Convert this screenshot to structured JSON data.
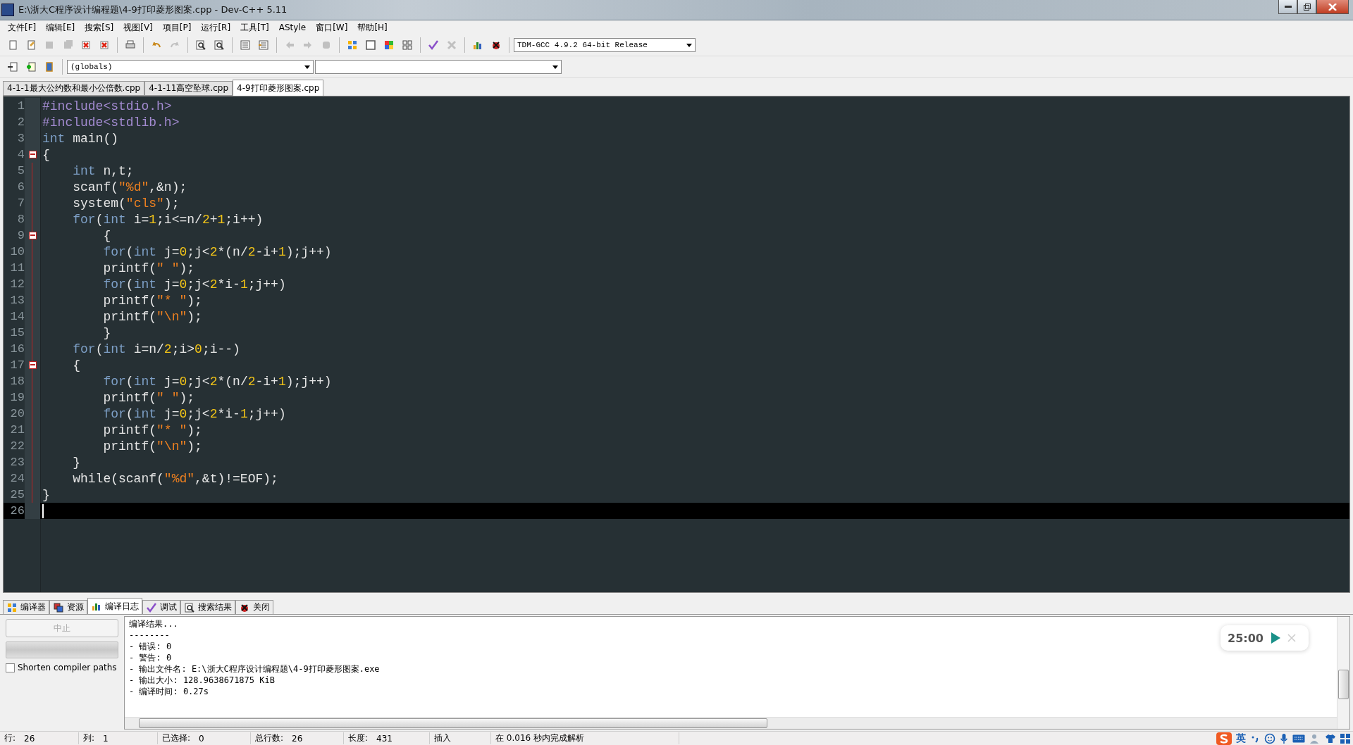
{
  "window": {
    "title": "E:\\浙大C程序设计编程题\\4-9打印菱形图案.cpp - Dev-C++ 5.11"
  },
  "menu": [
    "文件[F]",
    "编辑[E]",
    "搜索[S]",
    "视图[V]",
    "项目[P]",
    "运行[R]",
    "工具[T]",
    "AStyle",
    "窗口[W]",
    "帮助[H]"
  ],
  "toolbar": [
    {
      "kind": "new",
      "disabled": false
    },
    {
      "kind": "open",
      "disabled": false
    },
    {
      "kind": "save",
      "disabled": true
    },
    {
      "kind": "saveall",
      "disabled": true
    },
    {
      "kind": "close",
      "disabled": false
    },
    {
      "kind": "closeall",
      "disabled": false
    },
    {
      "kind": "sep"
    },
    {
      "kind": "print",
      "disabled": false
    },
    {
      "kind": "sep"
    },
    {
      "kind": "undo",
      "disabled": false
    },
    {
      "kind": "redo",
      "disabled": true
    },
    {
      "kind": "sep"
    },
    {
      "kind": "find",
      "disabled": false
    },
    {
      "kind": "replace",
      "disabled": false
    },
    {
      "kind": "sep"
    },
    {
      "kind": "indent",
      "disabled": false
    },
    {
      "kind": "unindent",
      "disabled": false
    },
    {
      "kind": "sep"
    },
    {
      "kind": "back",
      "disabled": true
    },
    {
      "kind": "forward",
      "disabled": true
    },
    {
      "kind": "bookmark",
      "disabled": true
    },
    {
      "kind": "sep"
    },
    {
      "kind": "tiles",
      "disabled": false
    },
    {
      "kind": "window",
      "disabled": false
    },
    {
      "kind": "colorgrid",
      "disabled": false
    },
    {
      "kind": "grid",
      "disabled": false
    },
    {
      "kind": "sep"
    },
    {
      "kind": "check",
      "disabled": false
    },
    {
      "kind": "stop",
      "disabled": true
    },
    {
      "kind": "sep"
    },
    {
      "kind": "chart",
      "disabled": false
    },
    {
      "kind": "debug",
      "disabled": false
    }
  ],
  "compiler_select": {
    "value": "TDM-GCC 4.9.2 64-bit Release"
  },
  "toolbar2": [
    {
      "kind": "insert",
      "disabled": false
    },
    {
      "kind": "add",
      "disabled": false
    },
    {
      "kind": "class",
      "disabled": false
    }
  ],
  "scope_select": {
    "value": "(globals)"
  },
  "file_tabs": [
    {
      "label": "4-1-1最大公约数和最小公倍数.cpp",
      "selected": false
    },
    {
      "label": "4-1-11高空坠球.cpp",
      "selected": false
    },
    {
      "label": "4-9打印菱形图案.cpp",
      "selected": true
    }
  ],
  "editor": {
    "lines": [
      {
        "num": "1",
        "fold": false,
        "current": false,
        "tokens": [
          {
            "kind": "pre",
            "text": "#include<stdio.h>"
          }
        ]
      },
      {
        "num": "2",
        "fold": false,
        "current": false,
        "tokens": [
          {
            "kind": "pre",
            "text": "#include<stdlib.h>"
          }
        ]
      },
      {
        "num": "3",
        "fold": false,
        "current": false,
        "tokens": [
          {
            "kind": "kw",
            "text": "int"
          },
          {
            "kind": "plain",
            "text": " main()"
          }
        ]
      },
      {
        "num": "4",
        "fold": true,
        "current": false,
        "tokens": [
          {
            "kind": "plain",
            "text": "{"
          }
        ]
      },
      {
        "num": "5",
        "fold": false,
        "current": false,
        "tokens": [
          {
            "kind": "kw",
            "text": "    int"
          },
          {
            "kind": "plain",
            "text": " n,t;"
          }
        ]
      },
      {
        "num": "6",
        "fold": false,
        "current": false,
        "tokens": [
          {
            "kind": "plain",
            "text": "    scanf("
          },
          {
            "kind": "str",
            "text": "\"%d\""
          },
          {
            "kind": "plain",
            "text": ",&n);"
          }
        ]
      },
      {
        "num": "7",
        "fold": false,
        "current": false,
        "tokens": [
          {
            "kind": "plain",
            "text": "    system("
          },
          {
            "kind": "str",
            "text": "\"cls\""
          },
          {
            "kind": "plain",
            "text": ");"
          }
        ]
      },
      {
        "num": "8",
        "fold": false,
        "current": false,
        "tokens": [
          {
            "kind": "kw",
            "text": "    for"
          },
          {
            "kind": "plain",
            "text": "("
          },
          {
            "kind": "kw",
            "text": "int"
          },
          {
            "kind": "plain",
            "text": " i="
          },
          {
            "kind": "num",
            "text": "1"
          },
          {
            "kind": "plain",
            "text": ";i<=n/"
          },
          {
            "kind": "num",
            "text": "2"
          },
          {
            "kind": "plain",
            "text": "+"
          },
          {
            "kind": "num",
            "text": "1"
          },
          {
            "kind": "plain",
            "text": ";i++)"
          }
        ]
      },
      {
        "num": "9",
        "fold": true,
        "current": false,
        "tokens": [
          {
            "kind": "plain",
            "text": "        {"
          }
        ]
      },
      {
        "num": "10",
        "fold": false,
        "current": false,
        "tokens": [
          {
            "kind": "kw",
            "text": "        for"
          },
          {
            "kind": "plain",
            "text": "("
          },
          {
            "kind": "kw",
            "text": "int"
          },
          {
            "kind": "plain",
            "text": " j="
          },
          {
            "kind": "num",
            "text": "0"
          },
          {
            "kind": "plain",
            "text": ";j<"
          },
          {
            "kind": "num",
            "text": "2"
          },
          {
            "kind": "plain",
            "text": "*(n/"
          },
          {
            "kind": "num",
            "text": "2"
          },
          {
            "kind": "plain",
            "text": "-i+"
          },
          {
            "kind": "num",
            "text": "1"
          },
          {
            "kind": "plain",
            "text": ");j++)"
          }
        ]
      },
      {
        "num": "11",
        "fold": false,
        "current": false,
        "tokens": [
          {
            "kind": "plain",
            "text": "        printf("
          },
          {
            "kind": "str",
            "text": "\" \""
          },
          {
            "kind": "plain",
            "text": ");"
          }
        ]
      },
      {
        "num": "12",
        "fold": false,
        "current": false,
        "tokens": [
          {
            "kind": "kw",
            "text": "        for"
          },
          {
            "kind": "plain",
            "text": "("
          },
          {
            "kind": "kw",
            "text": "int"
          },
          {
            "kind": "plain",
            "text": " j="
          },
          {
            "kind": "num",
            "text": "0"
          },
          {
            "kind": "plain",
            "text": ";j<"
          },
          {
            "kind": "num",
            "text": "2"
          },
          {
            "kind": "plain",
            "text": "*i-"
          },
          {
            "kind": "num",
            "text": "1"
          },
          {
            "kind": "plain",
            "text": ";j++)"
          }
        ]
      },
      {
        "num": "13",
        "fold": false,
        "current": false,
        "tokens": [
          {
            "kind": "plain",
            "text": "        printf("
          },
          {
            "kind": "str",
            "text": "\"* \""
          },
          {
            "kind": "plain",
            "text": ");"
          }
        ]
      },
      {
        "num": "14",
        "fold": false,
        "current": false,
        "tokens": [
          {
            "kind": "plain",
            "text": "        printf("
          },
          {
            "kind": "str",
            "text": "\"\\n\""
          },
          {
            "kind": "plain",
            "text": ");"
          }
        ]
      },
      {
        "num": "15",
        "fold": false,
        "current": false,
        "tokens": [
          {
            "kind": "plain",
            "text": "        }"
          }
        ]
      },
      {
        "num": "16",
        "fold": false,
        "current": false,
        "tokens": [
          {
            "kind": "kw",
            "text": "    for"
          },
          {
            "kind": "plain",
            "text": "("
          },
          {
            "kind": "kw",
            "text": "int"
          },
          {
            "kind": "plain",
            "text": " i=n/"
          },
          {
            "kind": "num",
            "text": "2"
          },
          {
            "kind": "plain",
            "text": ";i>"
          },
          {
            "kind": "num",
            "text": "0"
          },
          {
            "kind": "plain",
            "text": ";i--)"
          }
        ]
      },
      {
        "num": "17",
        "fold": true,
        "current": false,
        "tokens": [
          {
            "kind": "plain",
            "text": "    {"
          }
        ]
      },
      {
        "num": "18",
        "fold": false,
        "current": false,
        "tokens": [
          {
            "kind": "kw",
            "text": "        for"
          },
          {
            "kind": "plain",
            "text": "("
          },
          {
            "kind": "kw",
            "text": "int"
          },
          {
            "kind": "plain",
            "text": " j="
          },
          {
            "kind": "num",
            "text": "0"
          },
          {
            "kind": "plain",
            "text": ";j<"
          },
          {
            "kind": "num",
            "text": "2"
          },
          {
            "kind": "plain",
            "text": "*(n/"
          },
          {
            "kind": "num",
            "text": "2"
          },
          {
            "kind": "plain",
            "text": "-i+"
          },
          {
            "kind": "num",
            "text": "1"
          },
          {
            "kind": "plain",
            "text": ");j++)"
          }
        ]
      },
      {
        "num": "19",
        "fold": false,
        "current": false,
        "tokens": [
          {
            "kind": "plain",
            "text": "        printf("
          },
          {
            "kind": "str",
            "text": "\" \""
          },
          {
            "kind": "plain",
            "text": ");"
          }
        ]
      },
      {
        "num": "20",
        "fold": false,
        "current": false,
        "tokens": [
          {
            "kind": "kw",
            "text": "        for"
          },
          {
            "kind": "plain",
            "text": "("
          },
          {
            "kind": "kw",
            "text": "int"
          },
          {
            "kind": "plain",
            "text": " j="
          },
          {
            "kind": "num",
            "text": "0"
          },
          {
            "kind": "plain",
            "text": ";j<"
          },
          {
            "kind": "num",
            "text": "2"
          },
          {
            "kind": "plain",
            "text": "*i-"
          },
          {
            "kind": "num",
            "text": "1"
          },
          {
            "kind": "plain",
            "text": ";j++)"
          }
        ]
      },
      {
        "num": "21",
        "fold": false,
        "current": false,
        "tokens": [
          {
            "kind": "plain",
            "text": "        printf("
          },
          {
            "kind": "str",
            "text": "\"* \""
          },
          {
            "kind": "plain",
            "text": ");"
          }
        ]
      },
      {
        "num": "22",
        "fold": false,
        "current": false,
        "tokens": [
          {
            "kind": "plain",
            "text": "        printf("
          },
          {
            "kind": "str",
            "text": "\"\\n\""
          },
          {
            "kind": "plain",
            "text": ");"
          }
        ]
      },
      {
        "num": "23",
        "fold": false,
        "current": false,
        "tokens": [
          {
            "kind": "plain",
            "text": "    }"
          }
        ]
      },
      {
        "num": "24",
        "fold": false,
        "current": false,
        "tokens": [
          {
            "kind": "plain",
            "text": "    while(scanf("
          },
          {
            "kind": "str",
            "text": "\"%d\""
          },
          {
            "kind": "plain",
            "text": ",&t)!=EOF);"
          }
        ]
      },
      {
        "num": "25",
        "fold": false,
        "current": false,
        "tokens": [
          {
            "kind": "plain",
            "text": "}"
          }
        ]
      },
      {
        "num": "26",
        "fold": false,
        "current": true
      }
    ]
  },
  "bottom_tabs": [
    {
      "kind": "compiler",
      "label": "编译器",
      "selected": false
    },
    {
      "kind": "resources",
      "label": "资源",
      "selected": false
    },
    {
      "kind": "log",
      "label": "编译日志",
      "selected": true
    },
    {
      "kind": "debug",
      "label": "调试",
      "selected": false
    },
    {
      "kind": "search",
      "label": "搜索结果",
      "selected": false
    },
    {
      "kind": "close",
      "label": "关闭",
      "selected": false
    }
  ],
  "log_panel": {
    "abort_button": {
      "label": "中止",
      "disabled": true
    },
    "progress": {
      "level": 0
    },
    "shorten_paths": {
      "label": "Shorten compiler paths",
      "checked": false
    },
    "output": [
      "编译结果...",
      "--------",
      "- 错误: 0",
      "- 警告: 0",
      "- 输出文件名: E:\\浙大C程序设计编程题\\4-9打印菱形图案.exe",
      "- 输出大小: 128.9638671875 KiB",
      "- 编译时间: 0.27s"
    ]
  },
  "timer": {
    "time": "25:00"
  },
  "status_bar": [
    {
      "label": "行:",
      "value": "26"
    },
    {
      "label": "列:",
      "value": "1"
    },
    {
      "label": "已选择:",
      "value": "0"
    },
    {
      "label": "总行数:",
      "value": "26"
    },
    {
      "label": "长度:",
      "value": "431"
    },
    {
      "value": "插入"
    },
    {
      "value": "在 0.016 秒内完成解析"
    }
  ],
  "ime": {
    "mode": "英"
  }
}
